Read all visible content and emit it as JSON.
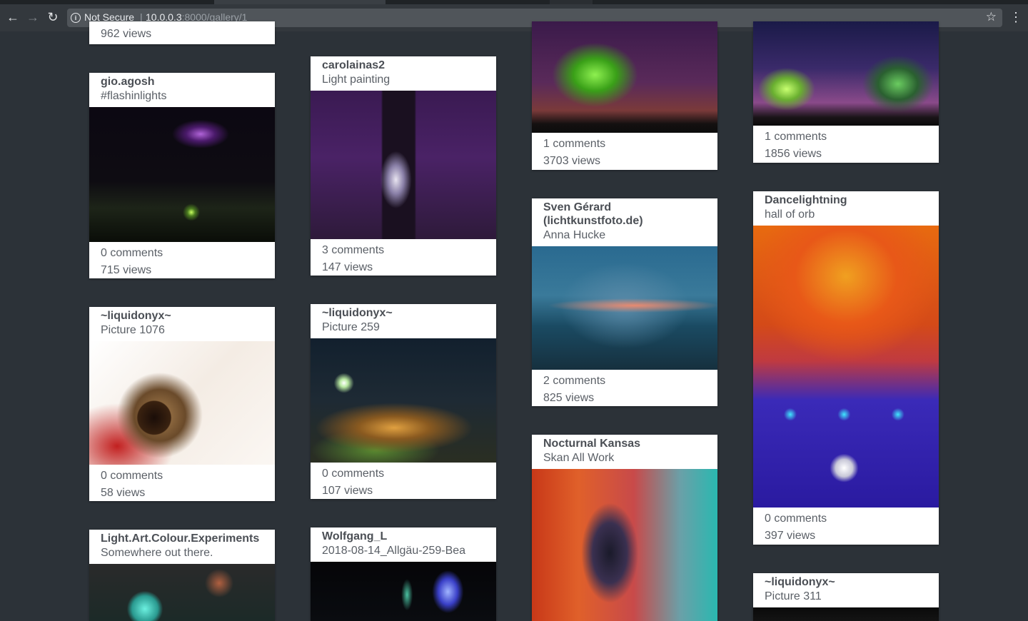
{
  "browser": {
    "security_label": "Not Secure",
    "url_host": "10.0.0.3",
    "url_rest": ":8000/gallery/1"
  },
  "cards": {
    "c1_top": {
      "views": "962 views"
    },
    "c1_gio": {
      "user": "gio.agosh",
      "title": "#flashinlights",
      "comments": "0 comments",
      "views": "715 views"
    },
    "c1_liq1076": {
      "user": "~liquidonyx~",
      "title": "Picture 1076",
      "comments": "0 comments",
      "views": "58 views"
    },
    "c1_light": {
      "user": "Light.Art.Colour.Experiments",
      "title": "Somewhere out there."
    },
    "c2_carol": {
      "user": "carolainas2",
      "title": "Light painting",
      "comments": "3 comments",
      "views": "147 views"
    },
    "c2_liq259": {
      "user": "~liquidonyx~",
      "title": "Picture 259",
      "comments": "0 comments",
      "views": "107 views"
    },
    "c2_wolf": {
      "user": "Wolfgang_L",
      "title": "2018-08-14_Allgäu-259-Bea"
    },
    "c3_tree": {
      "comments": "1 comments",
      "views": "3703 views"
    },
    "c3_sven": {
      "user": "Sven Gérard (lichtkunstfoto.de)",
      "title": "Anna Hucke",
      "comments": "2 comments",
      "views": "825 views"
    },
    "c3_noct": {
      "user": "Nocturnal Kansas",
      "title": "Skan All Work"
    },
    "c4_stars": {
      "comments": "1 comments",
      "views": "1856 views"
    },
    "c4_dance": {
      "user": "Dancelightning",
      "title": "hall of orb",
      "comments": "0 comments",
      "views": "397 views"
    },
    "c4_liq311": {
      "user": "~liquidonyx~",
      "title": "Picture 311"
    }
  }
}
